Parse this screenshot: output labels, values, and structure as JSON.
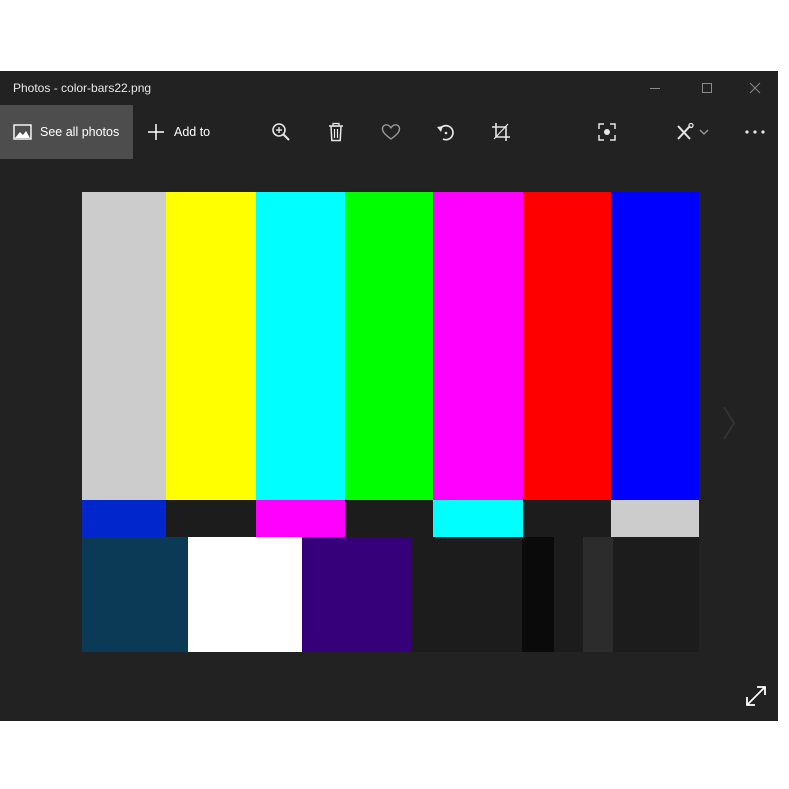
{
  "window": {
    "title": "Photos - color-bars22.png"
  },
  "toolbar": {
    "see_all_label": "See all photos",
    "add_to_label": "Add to"
  },
  "image": {
    "top_bars": [
      "#cccccc",
      "#ffff00",
      "#00ffff",
      "#00ff00",
      "#ff00ff",
      "#ff0000",
      "#0000ff"
    ],
    "middle_bars": [
      "#0026cc",
      "#1c1c1c",
      "#ff00ff",
      "#1c1c1c",
      "#00ffff",
      "#1c1c1c",
      "#cccccc"
    ],
    "bottom_blocks": [
      "#0a3a56",
      "#ffffff",
      "#36007a",
      "#1c1c1c",
      "#0a0a0a",
      "#1c1c1c",
      "#2c2c2c",
      "#1c1c1c"
    ]
  },
  "colors": {
    "window_bg": "#222222",
    "selected_button_bg": "#4d4d4d",
    "icon": "#e6e6e6",
    "dim_icon": "#9a9a9a"
  }
}
